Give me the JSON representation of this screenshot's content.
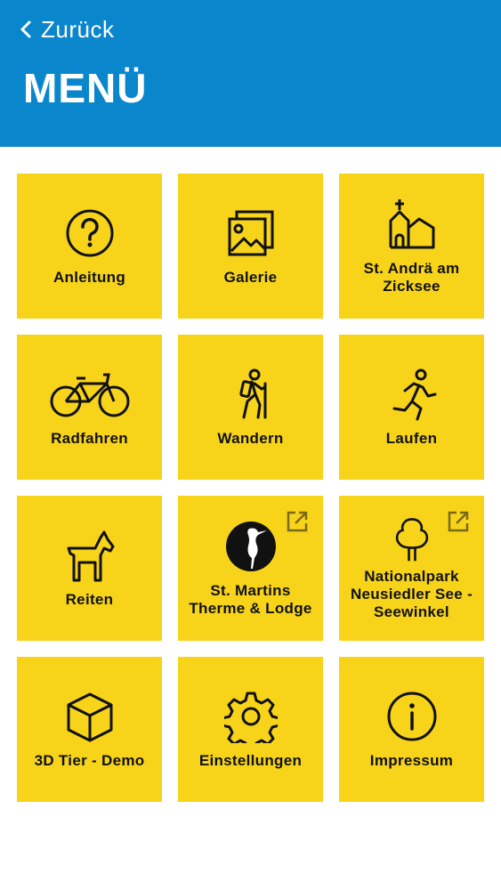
{
  "header": {
    "back_label": "Zurück",
    "title": "MENÜ",
    "color": "#0a87cc"
  },
  "tiles": [
    {
      "label": "Anleitung",
      "icon": "question-icon"
    },
    {
      "label": "Galerie",
      "icon": "gallery-icon"
    },
    {
      "label": "St. Andrä am Zicksee",
      "icon": "church-icon"
    },
    {
      "label": "Radfahren",
      "icon": "bicycle-icon"
    },
    {
      "label": "Wandern",
      "icon": "hiker-icon"
    },
    {
      "label": "Laufen",
      "icon": "runner-icon"
    },
    {
      "label": "Reiten",
      "icon": "horse-icon"
    },
    {
      "label": "St. Martins Therme & Lodge",
      "icon": "heron-logo-icon",
      "external": true
    },
    {
      "label": "Nationalpark Neusiedler See - Seewinkel",
      "icon": "tree-icon",
      "external": true
    },
    {
      "label": "3D Tier - Demo",
      "icon": "cube-icon"
    },
    {
      "label": "Einstellungen",
      "icon": "gear-icon"
    },
    {
      "label": "Impressum",
      "icon": "info-icon"
    }
  ],
  "tile_color": "#f7d41a"
}
